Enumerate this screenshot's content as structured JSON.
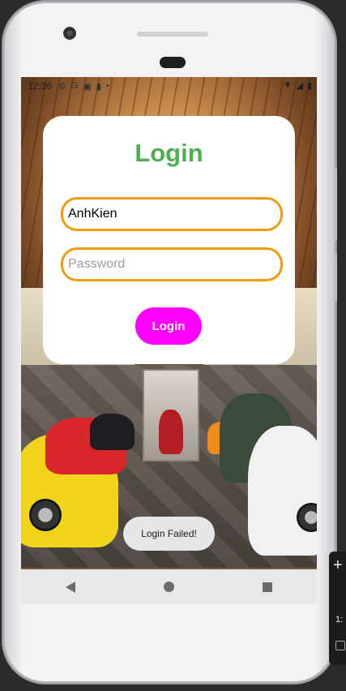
{
  "status_bar": {
    "time": "12:36"
  },
  "login_card": {
    "title": "Login",
    "username_value": "AnhKien",
    "password_placeholder": "Password",
    "login_button_label": "Login"
  },
  "toast": {
    "message": "Login Failed!"
  },
  "emulator_toolbar": {
    "plus_label": "+",
    "time_label": "1:"
  },
  "colors": {
    "title": "#4caf50",
    "field_border": "#f39c12",
    "button_bg": "#ff00ff",
    "toast_bg": "#e6e6e6"
  }
}
